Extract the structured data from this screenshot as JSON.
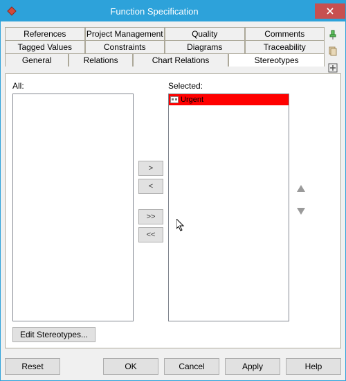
{
  "window": {
    "title": "Function Specification"
  },
  "tabs": {
    "row1": [
      "References",
      "Project Management",
      "Quality",
      "Comments"
    ],
    "row2": [
      "Tagged Values",
      "Constraints",
      "Diagrams",
      "Traceability"
    ],
    "row3": [
      "General",
      "Relations",
      "Chart Relations",
      "Stereotypes"
    ],
    "active": "Stereotypes"
  },
  "panel": {
    "all_label": "All:",
    "selected_label": "Selected:",
    "selected_items": [
      {
        "name": "Urgent",
        "highlighted": true
      }
    ],
    "transfer": {
      "add": ">",
      "remove": "<",
      "add_all": ">>",
      "remove_all": "<<"
    },
    "edit_button": "Edit Stereotypes..."
  },
  "footer": {
    "reset": "Reset",
    "ok": "OK",
    "cancel": "Cancel",
    "apply": "Apply",
    "help": "Help"
  }
}
